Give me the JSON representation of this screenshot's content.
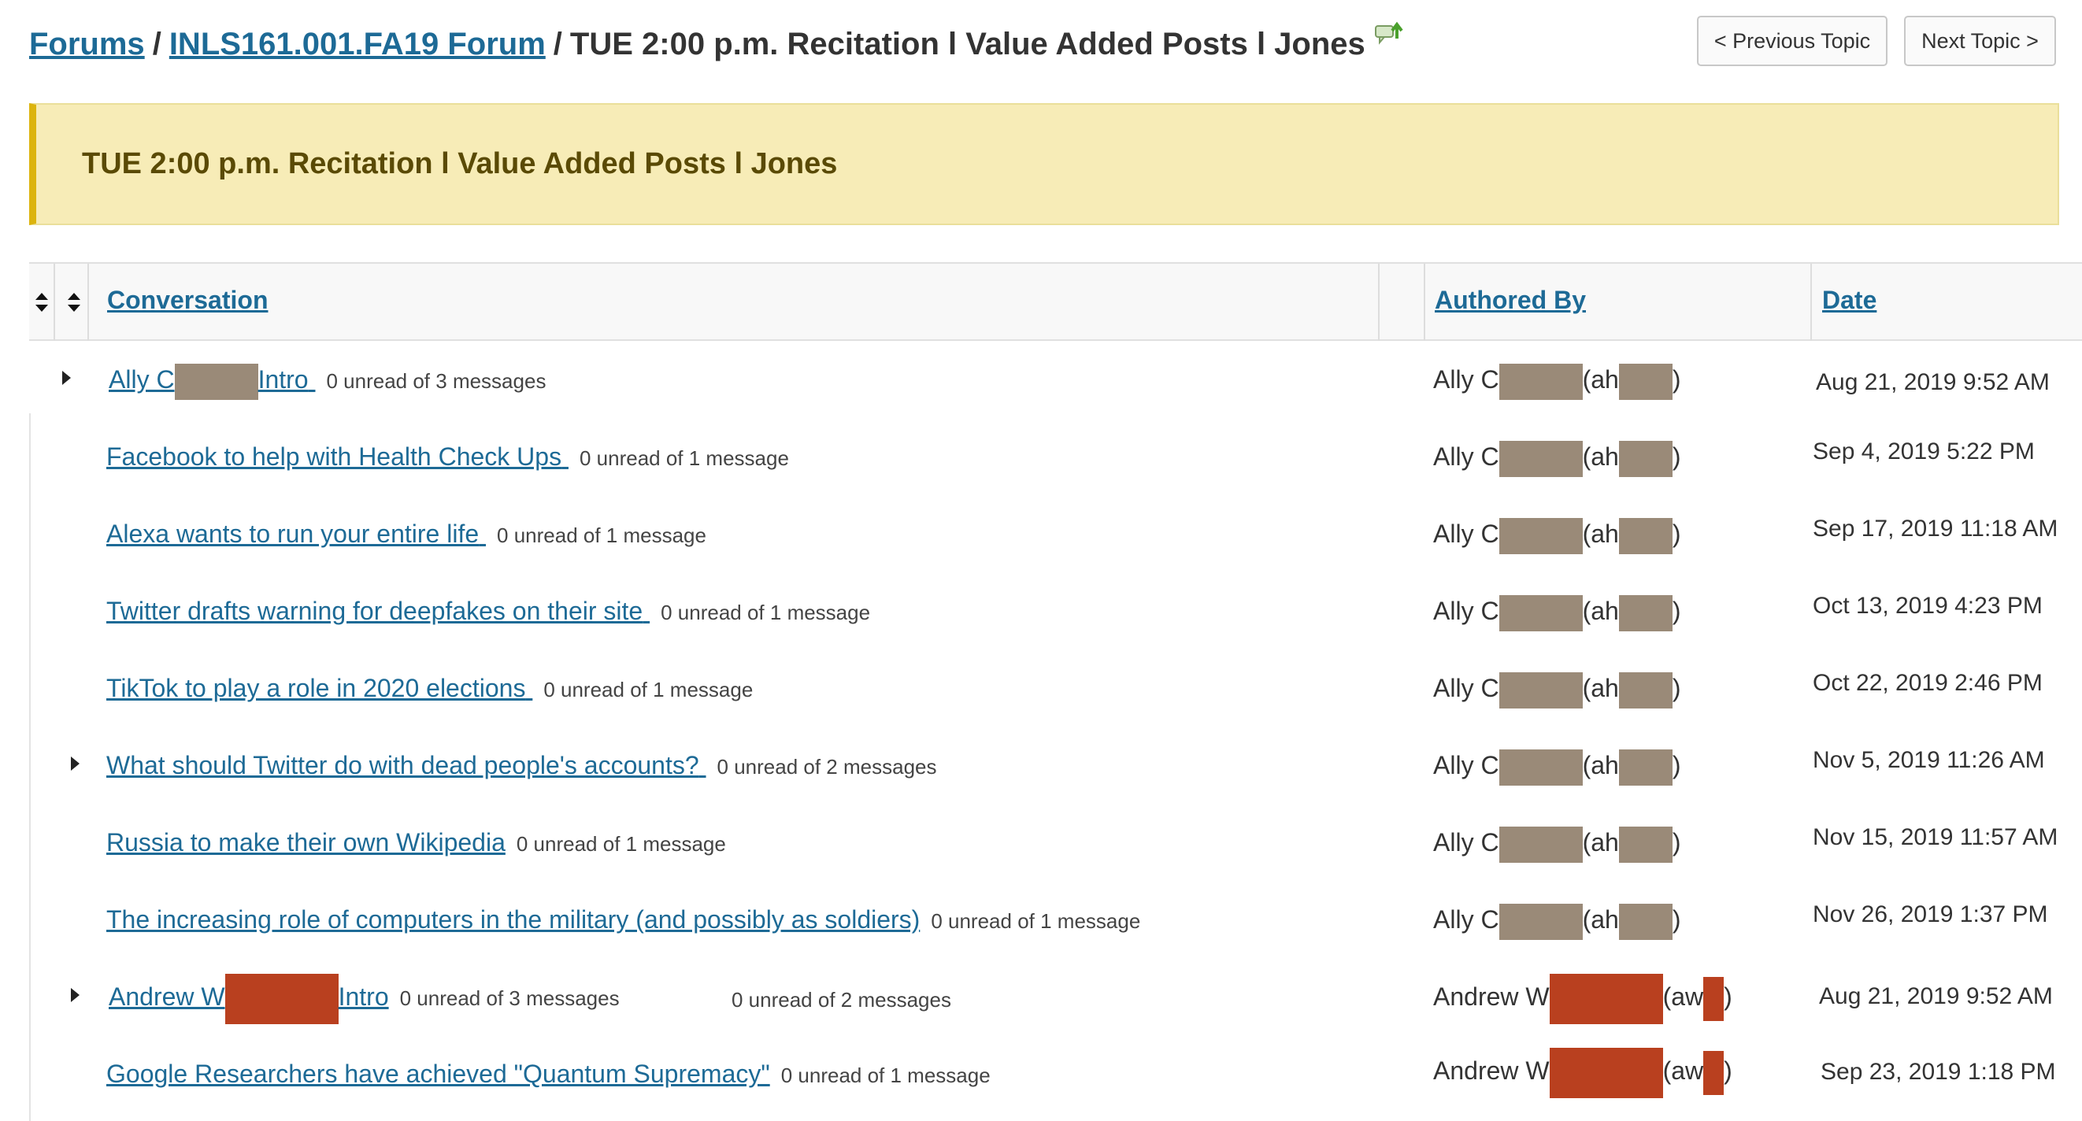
{
  "breadcrumb": {
    "forums": "Forums",
    "forum": "INLS161.001.FA19 Forum",
    "separator": "/",
    "topic": "TUE 2:00 p.m. Recitation l Value Added Posts l Jones",
    "watch_icon": "watch-topic-icon"
  },
  "nav": {
    "previous": "< Previous Topic",
    "next": "Next Topic >"
  },
  "banner": {
    "text": "TUE 2:00 p.m. Recitation l Value Added Posts l Jones"
  },
  "table": {
    "columns": {
      "conversation": "Conversation",
      "authored_by": "Authored By",
      "date": "Date"
    },
    "rows": [
      {
        "title_a": "Ally C",
        "title_b": "Intro",
        "unread": "0 unread of 3 messages",
        "author_a": "Ally C",
        "author_b": "(ah",
        "author_c": ")",
        "date": "Aug 21, 2019 9:52 AM"
      },
      {
        "title": "Facebook to help with Health Check Ups",
        "unread": "0 unread of 1 message",
        "author_a": "Ally C",
        "author_b": "(ah",
        "author_c": ")",
        "date": "Sep 4, 2019 5:22 PM"
      },
      {
        "title": "Alexa wants to run your entire life",
        "unread": "0 unread of 1 message",
        "author_a": "Ally C",
        "author_b": "(ah",
        "author_c": ")",
        "date": "Sep 17, 2019 11:18 AM"
      },
      {
        "title": "Twitter drafts warning for deepfakes on their site",
        "unread": "0 unread of 1 message",
        "author_a": "Ally C",
        "author_b": "(ah",
        "author_c": ")",
        "date": "Oct 13, 2019 4:23 PM"
      },
      {
        "title": "TikTok to play a role in 2020 elections",
        "unread": "0 unread of 1 message",
        "author_a": "Ally C",
        "author_b": "(ah",
        "author_c": ")",
        "date": "Oct 22, 2019 2:46 PM"
      },
      {
        "title": "What should Twitter do with dead people's accounts?",
        "unread": "0 unread of 2 messages",
        "author_a": "Ally C",
        "author_b": "(ah",
        "author_c": ")",
        "date": "Nov 5, 2019 11:26 AM"
      },
      {
        "title": "Russia to make their own Wikipedia",
        "unread": "0 unread of 1 message",
        "author_a": "Ally C",
        "author_b": "(ah",
        "author_c": ")",
        "date": "Nov 15, 2019 11:57 AM"
      },
      {
        "title": "The increasing role of computers in the military (and possibly as soldiers)",
        "unread": "0 unread of 1 message",
        "author_a": "Ally C",
        "author_b": "(ah",
        "author_c": ")",
        "date": "Nov 26, 2019 1:37 PM"
      },
      {
        "title_a": "Andrew W",
        "title_b": "Intro",
        "unread": "0 unread of 3 messages",
        "unread_extra": "0 unread of 2 messages",
        "author_a": "Andrew W",
        "author_b": "(aw",
        "author_c": ")",
        "date": "Aug 21, 2019 9:52 AM"
      },
      {
        "title": "Google Researchers have achieved \"Quantum Supremacy\"",
        "unread": "0 unread of 1 message",
        "author_a": "Andrew W",
        "author_b": "(aw",
        "author_c": ")",
        "date": "Sep 23, 2019 1:18 PM"
      }
    ]
  },
  "colors": {
    "link": "#1d6a96",
    "banner_bg": "#f7ecb7",
    "banner_accent": "#dcb40e",
    "redaction_gray": "#9a8a78",
    "redaction_red": "#b9401f"
  }
}
